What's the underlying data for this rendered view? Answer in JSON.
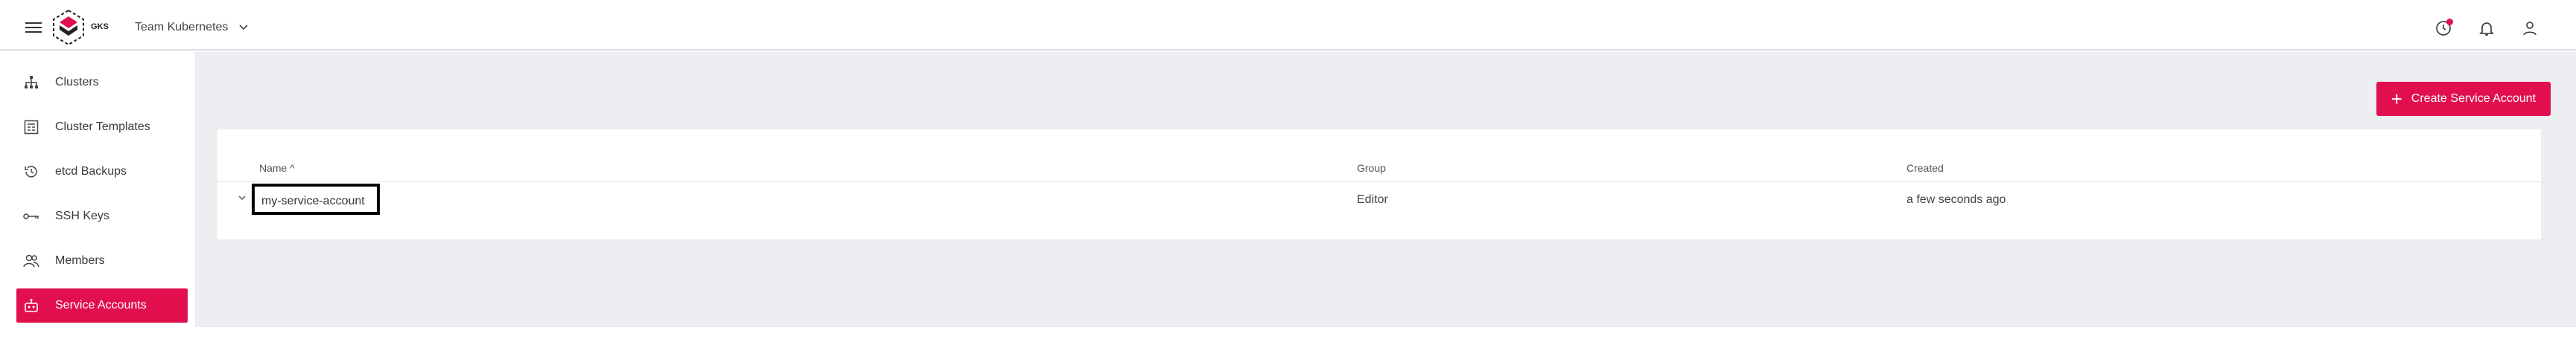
{
  "header": {
    "logo_text": "GKS",
    "project_name": "Team Kubernetes"
  },
  "sidebar": {
    "items": [
      {
        "label": "Clusters",
        "icon": "sitemap-icon"
      },
      {
        "label": "Cluster Templates",
        "icon": "template-icon"
      },
      {
        "label": "etcd Backups",
        "icon": "history-icon"
      },
      {
        "label": "SSH Keys",
        "icon": "key-icon"
      },
      {
        "label": "Members",
        "icon": "people-icon"
      },
      {
        "label": "Service Accounts",
        "icon": "robot-icon",
        "active": true
      }
    ]
  },
  "main": {
    "create_button": "Create Service Account",
    "table": {
      "columns": [
        "Name",
        "Group",
        "Created"
      ],
      "sort_indicator": "^",
      "rows": [
        {
          "name": "my-service-account",
          "group": "Editor",
          "created": "a few seconds ago"
        }
      ]
    }
  },
  "colors": {
    "accent": "#e20f4e",
    "background": "#eceef1"
  }
}
